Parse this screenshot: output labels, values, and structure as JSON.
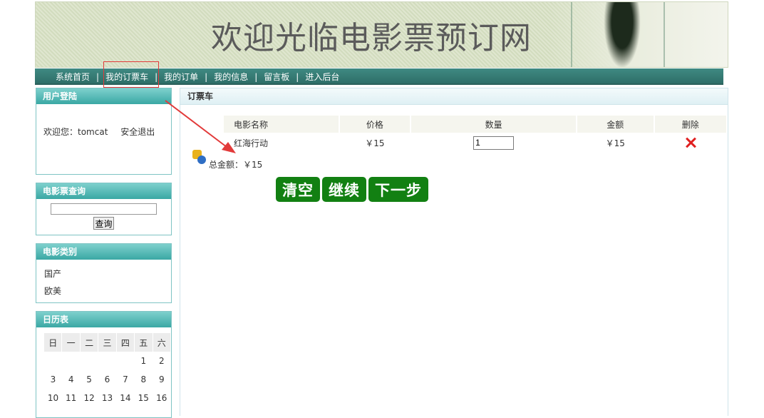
{
  "banner": {
    "title": "欢迎光临电影票预订网"
  },
  "nav": {
    "items": [
      "系统首页",
      "我的订票车",
      "我的订单",
      "我的信息",
      "留言板",
      "进入后台"
    ],
    "separator": "|"
  },
  "login": {
    "title": "用户登陆",
    "welcome": "欢迎您：tomcat",
    "logout": "安全退出"
  },
  "search": {
    "title": "电影票查询",
    "value": "",
    "button": "查询"
  },
  "category": {
    "title": "电影类别",
    "items": [
      "国产",
      "欧美"
    ]
  },
  "calendar": {
    "title": "日历表",
    "weekdays": [
      "日",
      "一",
      "二",
      "三",
      "四",
      "五",
      "六"
    ],
    "row1": [
      "",
      "",
      "",
      "",
      "",
      "1",
      "2"
    ],
    "row2": [
      "3",
      "4",
      "5",
      "6",
      "7",
      "8",
      "9"
    ],
    "row3": [
      "10",
      "11",
      "12",
      "13",
      "14",
      "15",
      "16"
    ]
  },
  "cart": {
    "title": "订票车",
    "headers": {
      "name": "电影名称",
      "price": "价格",
      "qty": "数量",
      "amount": "金额",
      "delete": "删除"
    },
    "rows": [
      {
        "name": "红海行动",
        "price": "￥15",
        "qty": "1",
        "amount": "￥15"
      }
    ],
    "total": "总金额：￥15",
    "buttons": {
      "clear": "清空",
      "continue": "继续",
      "next": "下一步"
    }
  },
  "colors": {
    "nav": "#2e6e68",
    "button": "#128012",
    "delete": "#e02020",
    "highlight": "#e23a3a"
  }
}
